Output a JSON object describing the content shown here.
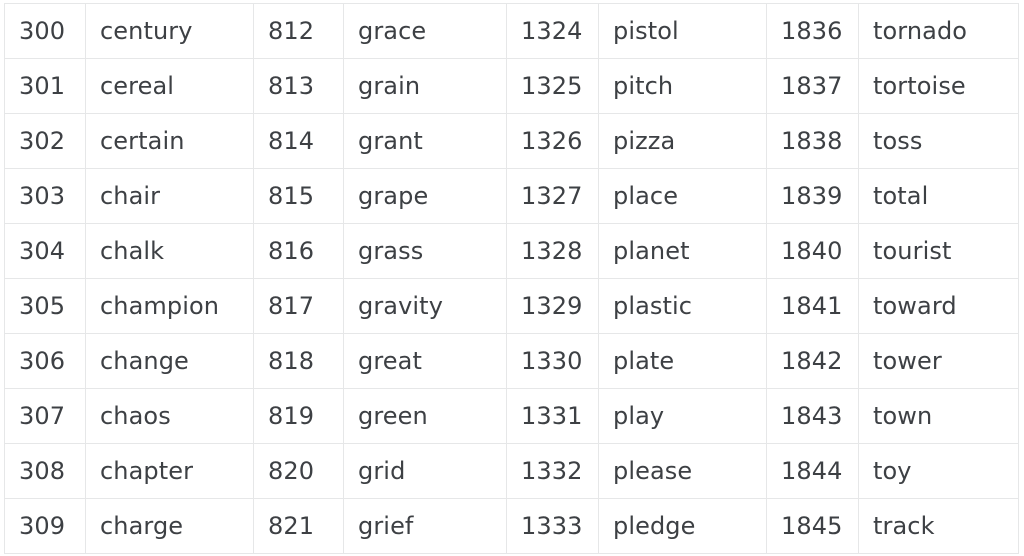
{
  "table": {
    "row_count_visible": 10,
    "column_groups": 4,
    "colors": {
      "text": "#3d4044",
      "border": "#e6e7e8",
      "background": "#ffffff"
    },
    "rows": [
      {
        "id1": "300",
        "word1": "century",
        "id2": "812",
        "word2": "grace",
        "id3": "1324",
        "word3": "pistol",
        "id4": "1836",
        "word4": "tornado"
      },
      {
        "id1": "301",
        "word1": "cereal",
        "id2": "813",
        "word2": "grain",
        "id3": "1325",
        "word3": "pitch",
        "id4": "1837",
        "word4": "tortoise"
      },
      {
        "id1": "302",
        "word1": "certain",
        "id2": "814",
        "word2": "grant",
        "id3": "1326",
        "word3": "pizza",
        "id4": "1838",
        "word4": "toss"
      },
      {
        "id1": "303",
        "word1": "chair",
        "id2": "815",
        "word2": "grape",
        "id3": "1327",
        "word3": "place",
        "id4": "1839",
        "word4": "total"
      },
      {
        "id1": "304",
        "word1": "chalk",
        "id2": "816",
        "word2": "grass",
        "id3": "1328",
        "word3": "planet",
        "id4": "1840",
        "word4": "tourist"
      },
      {
        "id1": "305",
        "word1": "champion",
        "id2": "817",
        "word2": "gravity",
        "id3": "1329",
        "word3": "plastic",
        "id4": "1841",
        "word4": "toward"
      },
      {
        "id1": "306",
        "word1": "change",
        "id2": "818",
        "word2": "great",
        "id3": "1330",
        "word3": "plate",
        "id4": "1842",
        "word4": "tower"
      },
      {
        "id1": "307",
        "word1": "chaos",
        "id2": "819",
        "word2": "green",
        "id3": "1331",
        "word3": "play",
        "id4": "1843",
        "word4": "town"
      },
      {
        "id1": "308",
        "word1": "chapter",
        "id2": "820",
        "word2": "grid",
        "id3": "1332",
        "word3": "please",
        "id4": "1844",
        "word4": "toy"
      },
      {
        "id1": "309",
        "word1": "charge",
        "id2": "821",
        "word2": "grief",
        "id3": "1333",
        "word3": "pledge",
        "id4": "1845",
        "word4": "track"
      }
    ]
  }
}
